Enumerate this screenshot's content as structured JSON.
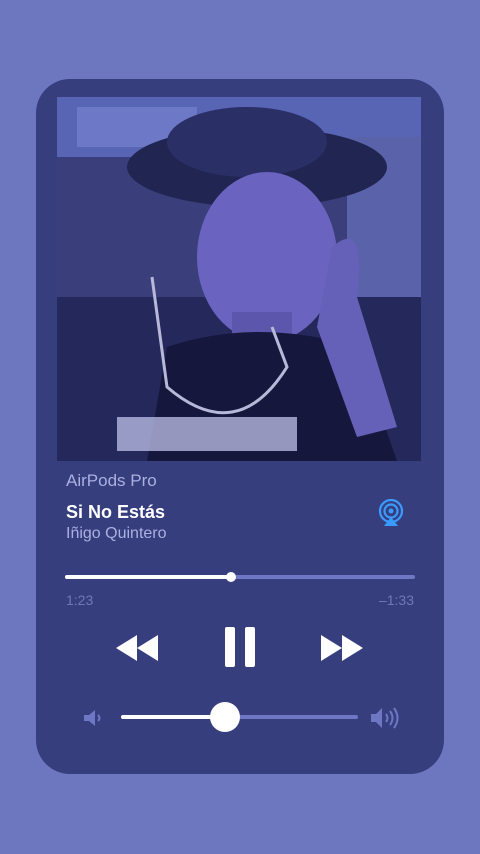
{
  "now_playing": {
    "device": "AirPods Pro",
    "title": "Si No Estás",
    "artist": "Iñigo Quintero",
    "elapsed": "1:23",
    "remaining": "–1:33",
    "progress_fraction": 0.475,
    "volume_fraction": 0.44
  },
  "icons": {
    "airplay": "airplay-icon",
    "rewind": "rewind-icon",
    "pause": "pause-icon",
    "fast_forward": "fast-forward-icon",
    "volume_low": "volume-low-icon",
    "volume_high": "volume-high-icon"
  },
  "colors": {
    "background": "#6d77c0",
    "card": "#363e7e",
    "accent": "#3a9bff",
    "text_primary": "#ffffff",
    "text_secondary": "#aab0e0"
  }
}
